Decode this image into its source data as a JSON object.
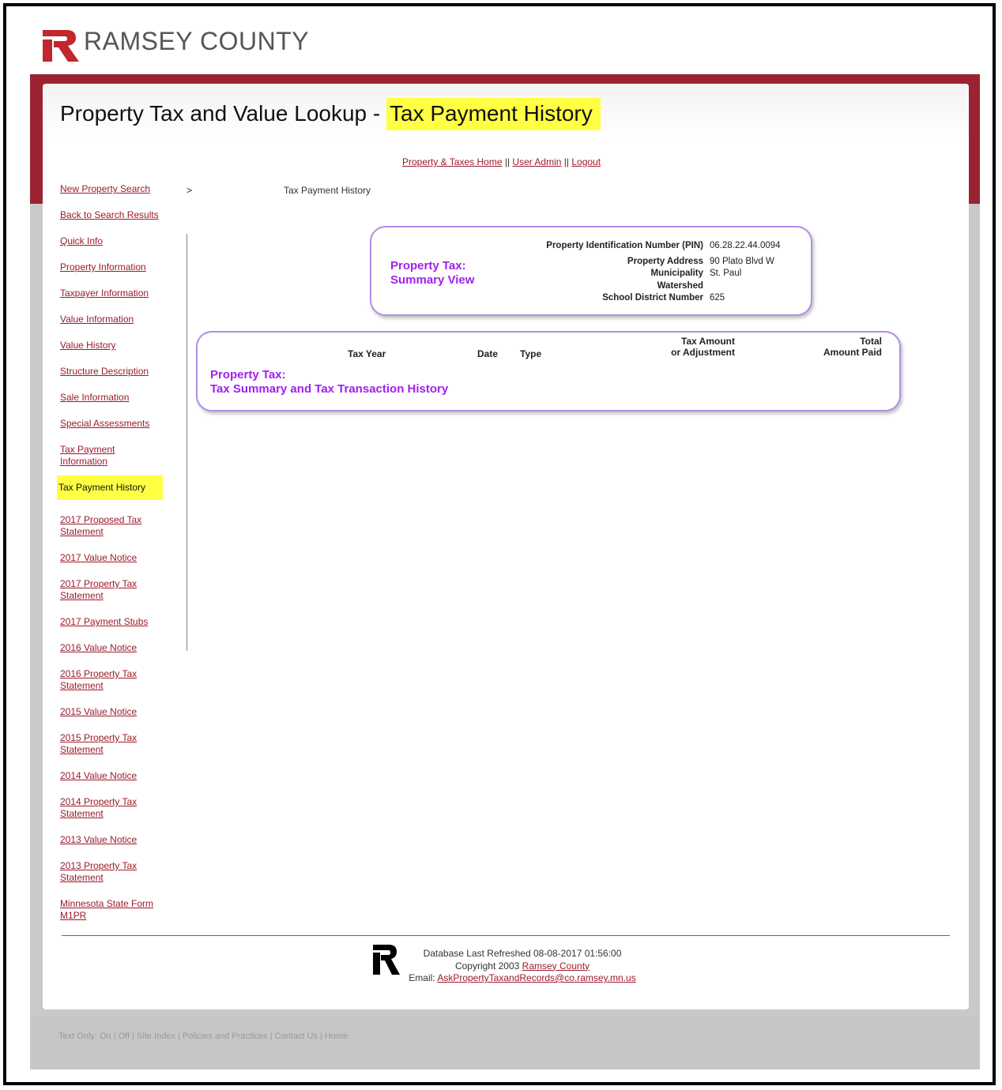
{
  "brand": {
    "name": "RAMSEY COUNTY",
    "red": "#9b2331"
  },
  "page": {
    "title_prefix": "Property Tax and Value Lookup - ",
    "title_highlight": "Tax Payment History"
  },
  "toplinks": {
    "home": "Property & Taxes Home",
    "sep": " || ",
    "admin": "User Admin",
    "logout": "Logout"
  },
  "breadcrumb": {
    "separator": ">",
    "current": "Tax Payment History"
  },
  "sidebar": {
    "items": [
      "New Property Search",
      "Back to Search Results",
      "Quick Info",
      "Property Information",
      "Taxpayer Information",
      "Value Information",
      "Value History",
      "Structure Description",
      "Sale Information",
      "Special Assessments",
      "Tax Payment Information",
      "Tax Payment History",
      "2017 Proposed Tax Statement",
      "2017 Value Notice",
      "2017 Property Tax Statement",
      "2017 Payment Stubs",
      "2016 Value Notice",
      "2016 Property Tax Statement",
      "2015 Value Notice",
      "2015 Property Tax Statement",
      "2014 Value Notice",
      "2014 Property Tax Statement",
      "2013 Value Notice",
      "2013 Property Tax Statement",
      "Minnesota State Form M1PR"
    ]
  },
  "summary": {
    "label_line1": "Property Tax:",
    "label_line2": "Summary View",
    "pin_label": "Property Identification Number (PIN)",
    "pin_value": "06.28.22.44.0094",
    "address_label": "Property Address",
    "address_value": "90 Plato Blvd W",
    "municipality_label": "Municipality",
    "municipality_value": "St. Paul",
    "watershed_label": "Watershed",
    "watershed_value": "",
    "school_label": "School District Number",
    "school_value": "625"
  },
  "history": {
    "label_line1": "Property Tax:",
    "label_line2": "Tax Summary and Tax Transaction History",
    "col_tax_year": "Tax Year",
    "col_date": "Date",
    "col_type": "Type",
    "col_amount_1": "Tax Amount",
    "col_amount_2": "or Adjustment",
    "col_total_1": "Total",
    "col_total_2": "Amount Paid"
  },
  "footer": {
    "refreshed": "Database Last Refreshed 08-08-2017 01:56:00",
    "copyright_prefix": "Copyright 2003 ",
    "copyright_link": "Ramsey County",
    "email_prefix": "Email: ",
    "email_link": "AskPropertyTaxandRecords@co.ramsey.mn.us",
    "bottom_links": "Text Only: On | Off | Site Index | Policies and Practices | Contact Us | Home"
  },
  "colors": {
    "purple": "#a020f0",
    "highlight": "#ffff44",
    "link": "#9b1b2b"
  }
}
